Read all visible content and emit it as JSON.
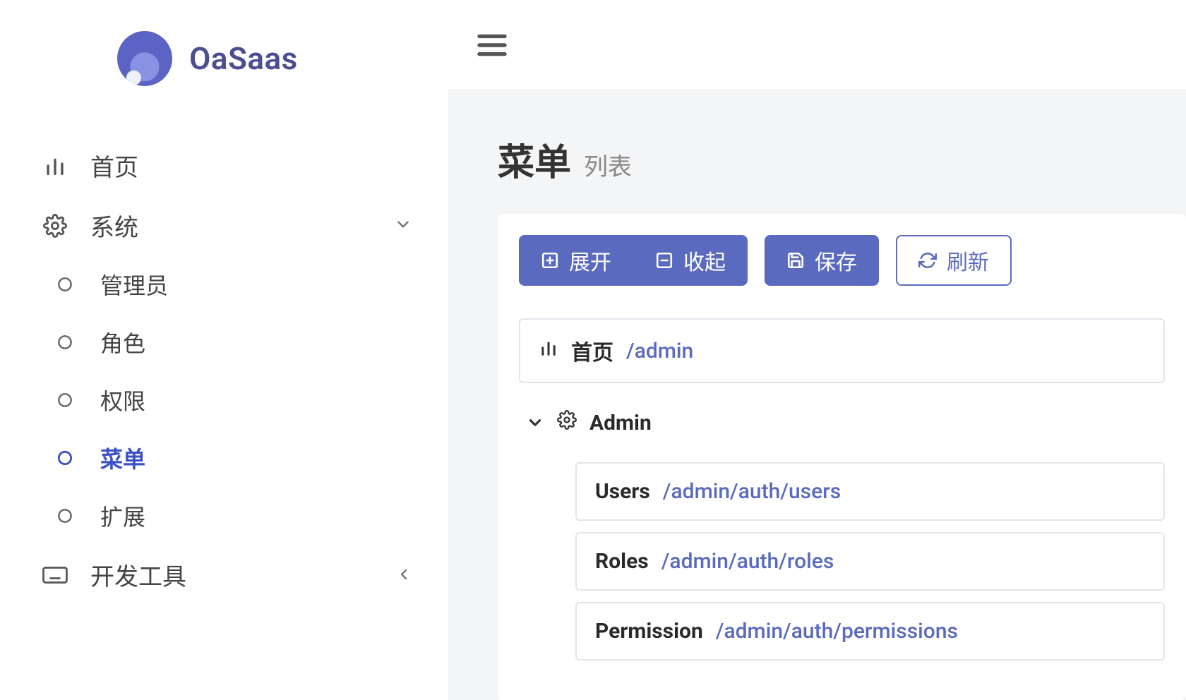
{
  "brand": {
    "name": "OaSaas"
  },
  "sidebar": {
    "items": [
      {
        "label": "首页"
      },
      {
        "label": "系统"
      },
      {
        "label": "开发工具"
      }
    ],
    "system_children": [
      {
        "label": "管理员"
      },
      {
        "label": "角色"
      },
      {
        "label": "权限"
      },
      {
        "label": "菜单"
      },
      {
        "label": "扩展"
      }
    ]
  },
  "page": {
    "title": "菜单",
    "subtitle": "列表"
  },
  "toolbar": {
    "expand": "展开",
    "collapse": "收起",
    "save": "保存",
    "refresh": "刷新"
  },
  "tree": {
    "root": {
      "name": "首页",
      "path": "/admin"
    },
    "admin": {
      "name": "Admin"
    },
    "children": [
      {
        "name": "Users",
        "path": "/admin/auth/users"
      },
      {
        "name": "Roles",
        "path": "/admin/auth/roles"
      },
      {
        "name": "Permission",
        "path": "/admin/auth/permissions"
      }
    ]
  }
}
